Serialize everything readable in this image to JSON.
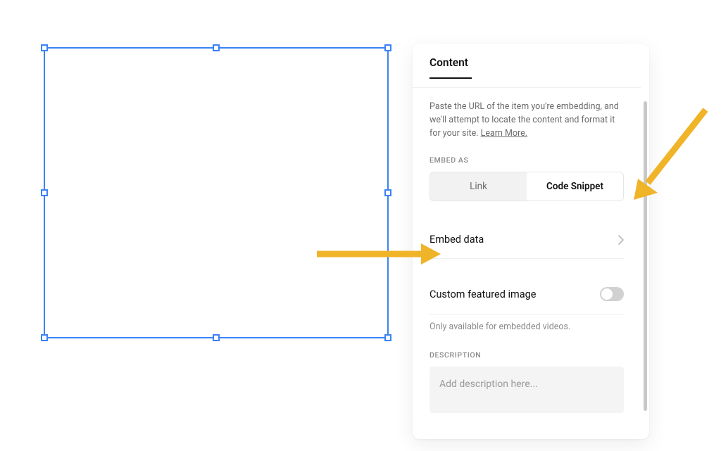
{
  "panel": {
    "tab_label": "Content",
    "help_text_prefix": "Paste the URL of the item you're embedding, and we'll attempt to locate the content and format it for your site. ",
    "help_link_label": "Learn More.",
    "embed_as_caption": "EMBED AS",
    "embed_as_options": {
      "link": "Link",
      "code_snippet": "Code Snippet"
    },
    "embed_data_label": "Embed data",
    "featured_label": "Custom featured image",
    "featured_note": "Only available for embedded videos.",
    "description_caption": "DESCRIPTION",
    "description_placeholder": "Add description here..."
  }
}
